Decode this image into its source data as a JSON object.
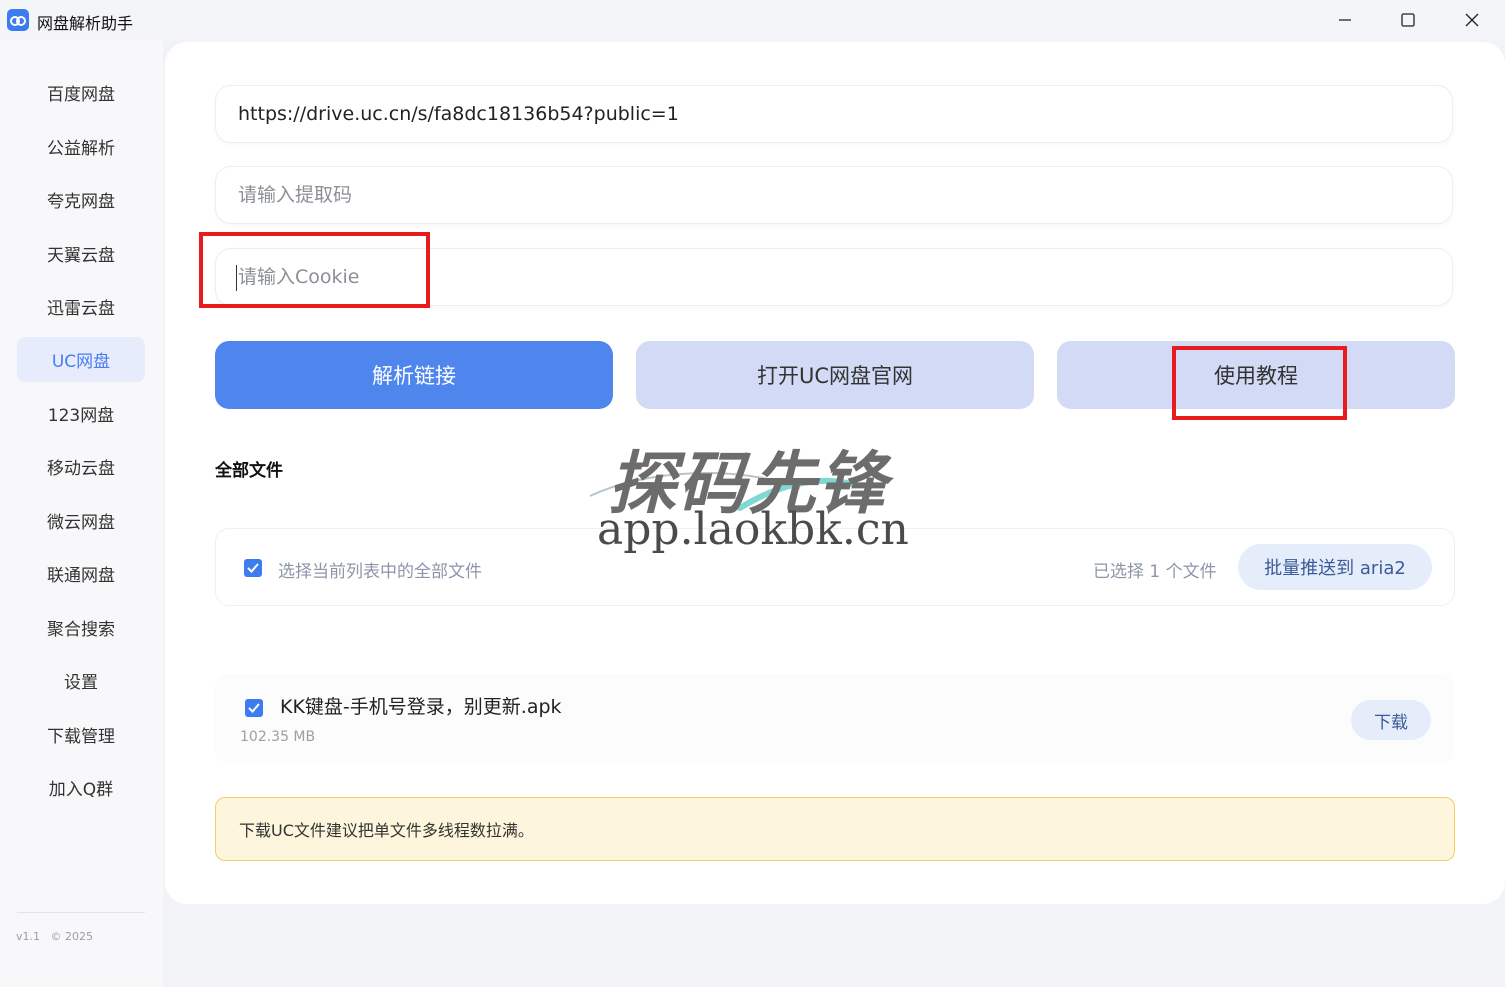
{
  "window": {
    "title": "网盘解析助手",
    "brand_color": "#3d7cf0"
  },
  "sidebar": {
    "items": [
      {
        "label": "百度网盘"
      },
      {
        "label": "公益解析"
      },
      {
        "label": "夸克网盘"
      },
      {
        "label": "天翼云盘"
      },
      {
        "label": "迅雷云盘"
      },
      {
        "label": "UC网盘",
        "active": true
      },
      {
        "label": "123网盘"
      },
      {
        "label": "移动云盘"
      },
      {
        "label": "微云网盘"
      },
      {
        "label": "联通网盘"
      },
      {
        "label": "聚合搜索"
      },
      {
        "label": "设置"
      },
      {
        "label": "下载管理"
      },
      {
        "label": "加入Q群"
      }
    ],
    "version": "v1.1",
    "copyright": "© 2025"
  },
  "form": {
    "url_value": "https://drive.uc.cn/s/fa8dc18136b54?public=1",
    "code_placeholder": "请输入提取码",
    "cookie_placeholder": "请输入Cookie"
  },
  "buttons": {
    "parse": "解析链接",
    "open_official": "打开UC网盘官网",
    "tutorial": "使用教程"
  },
  "files": {
    "section_title": "全部文件",
    "select_all_label": "选择当前列表中的全部文件",
    "selected_count": "已选择 1 个文件",
    "push_aria2": "批量推送到 aria2",
    "items": [
      {
        "name": "KK键盘-手机号登录，别更新.apk",
        "size": "102.35 MB",
        "checked": true,
        "action": "下载"
      }
    ]
  },
  "notice": "下载UC文件建议把单文件多线程数拉满。",
  "watermark": {
    "title": "探码先锋",
    "url": "app.laokbk.cn"
  },
  "colors": {
    "primary_button": "#4f86ee",
    "secondary_button": "#d3daf6",
    "highlight_box": "#e81c1c",
    "notice_bg": "#fdf5dc",
    "notice_border": "#f2cf67"
  }
}
